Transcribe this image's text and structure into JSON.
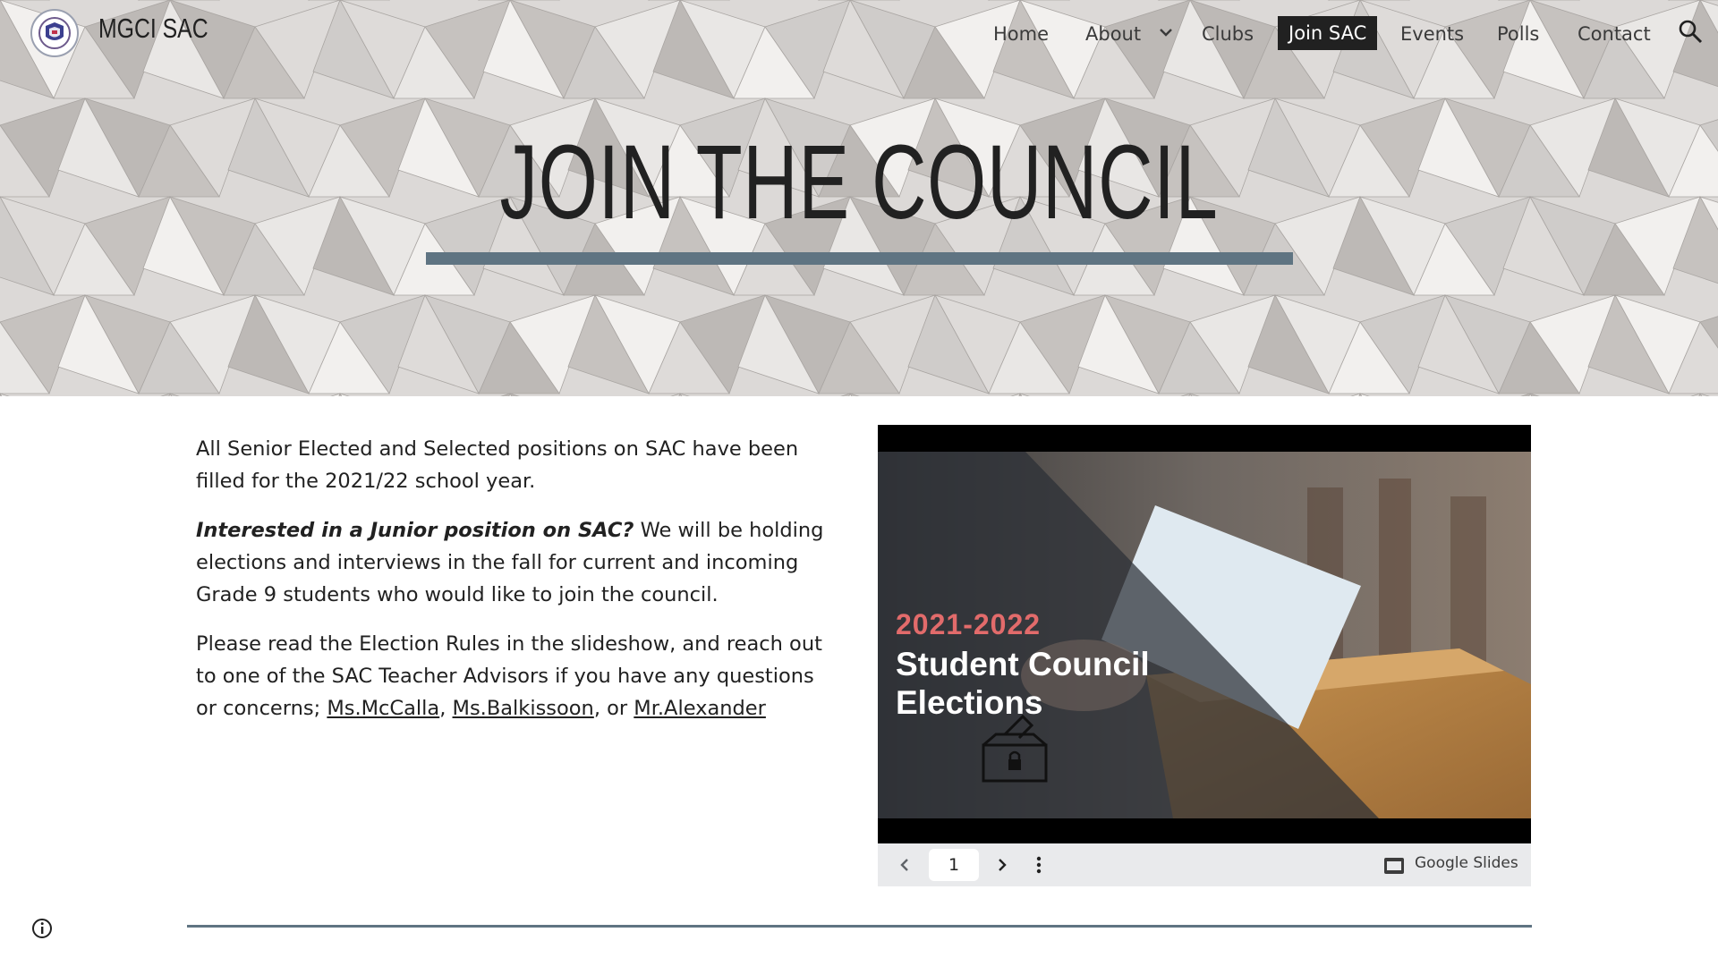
{
  "site": {
    "title": "MGCI SAC"
  },
  "nav": {
    "items": [
      {
        "label": "Home"
      },
      {
        "label": "About"
      },
      {
        "label": "Clubs"
      },
      {
        "label": "Join SAC"
      },
      {
        "label": "Events"
      },
      {
        "label": "Polls"
      },
      {
        "label": "Contact"
      }
    ],
    "active": "Join SAC",
    "search_icon": "search-icon"
  },
  "hero": {
    "title": "JOIN THE COUNCIL"
  },
  "content": {
    "p1": "All Senior Elected and Selected positions on SAC have been filled for the 2021/22 school year.",
    "p2_emphasis": "Interested in a Junior position on SAC?",
    "p2_text": " We will be holding elections and interviews in the fall for current and incoming Grade 9 students who would like to join the council.",
    "p3_text": "Please read the Election Rules in the slideshow, and reach out to one of the SAC Teacher Advisors if you have any questions or concerns; ",
    "advisors": [
      "Ms.McCalla",
      "Ms.Balkissoon",
      "Mr.Alexander"
    ],
    "sep1": ", ",
    "sep2": ", or "
  },
  "slides": {
    "year": "2021-2022",
    "title": "Student Council Elections",
    "page": "1",
    "brand": "Google Slides"
  },
  "colors": {
    "accent_rule": "#5f7482",
    "nav_active_bg": "#212121",
    "slide_year": "#e26b6b"
  }
}
